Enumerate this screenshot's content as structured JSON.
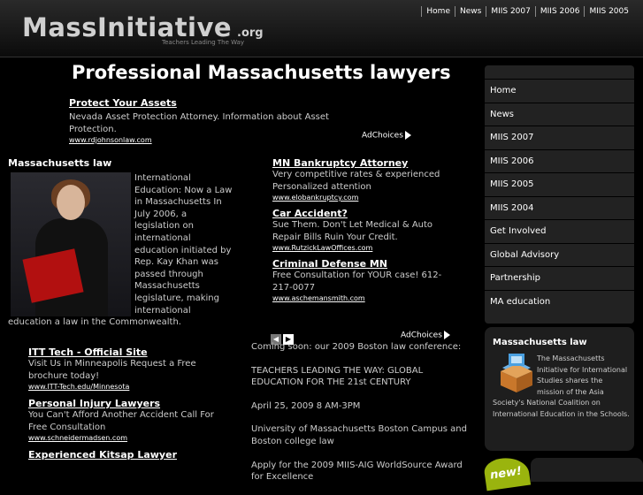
{
  "header": {
    "logo": "MassInitiative",
    "logo_suffix": ".org",
    "tagline": "Teachers Leading The Way",
    "top_nav": [
      "Home",
      "News",
      "MIIS 2007",
      "MIIS 2006",
      "MIIS 2005"
    ]
  },
  "main": {
    "headline": "Professional Massachusetts lawyers",
    "ad_top": {
      "title": "Protect Your Assets",
      "text": "Nevada Asset Protection Attorney. Information about Asset Protection.",
      "url": "www.rdjohnsonlaw.com"
    },
    "adchoices": "AdChoices",
    "ma_law": {
      "title": "Massachusetts law",
      "text": "International Education: Now a Law in Massachusetts In July 2006, a legislation on international education initiated by Rep. Kay Khan was passed through Massachusetts legislature, making international education a law in the Commonwealth."
    },
    "ads_right": [
      {
        "title": "MN Bankruptcy Attorney",
        "text": "Very competitive rates & experienced Personalized attention",
        "url": "www.elobankruptcy.com"
      },
      {
        "title": "Car Accident?",
        "text": "Sue Them. Don't Let Medical & Auto Repair Bills Ruin Your Credit.",
        "url": "www.RutzickLawOffices.com"
      },
      {
        "title": "Criminal Defense MN",
        "text": "Free Consultation for YOUR case! 612-217-0077",
        "url": "www.aschemansmith.com"
      }
    ],
    "ads_left": [
      {
        "title": "ITT Tech - Official Site",
        "text": "Visit Us in Minneapolis Request a Free brochure today!",
        "url": "www.ITT-Tech.edu/Minnesota"
      },
      {
        "title": "Personal Injury Lawyers",
        "text": "You Can't Afford Another Accident Call For Free Consultation",
        "url": "www.schneidermadsen.com"
      },
      {
        "title": "Experienced Kitsap Lawyer",
        "text": "",
        "url": ""
      }
    ],
    "news": [
      "Coming soon: our 2009 Boston law conference:",
      "TEACHERS LEADING THE WAY: GLOBAL EDUCATION FOR THE 21st CENTURY",
      "April 25, 2009 8 AM-3PM",
      "University of Massachusetts Boston Campus and Boston college law",
      "Apply for the 2009 MIIS-AIG WorldSource Award for Excellence"
    ]
  },
  "sidebar": {
    "nav": [
      "Home",
      "News",
      "MIIS 2007",
      "MIIS 2006",
      "MIIS 2005",
      "MIIS 2004",
      "Get Involved",
      "Global Advisory",
      "Partnership",
      "MA education"
    ],
    "box_title": "Massachusetts law",
    "box_text": "The Massachusetts Initiative for International Studies shares the mission of the Asia Society's National Coalition on International Education in the Schools.",
    "new_badge": "new!"
  },
  "colors": {
    "background": "#000000",
    "panel": "#222222",
    "accent_red": "#b21010",
    "badge_green": "#9ab40e"
  }
}
